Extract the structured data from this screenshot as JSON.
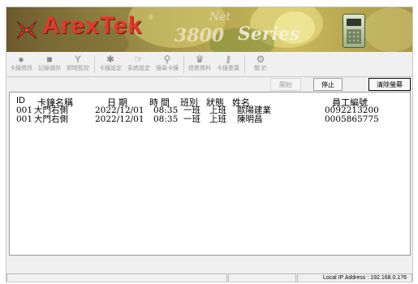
{
  "banner": {
    "brand": "ArexTek",
    "registered": "®",
    "model": "3800",
    "model_suffix": "Net",
    "series": "Series"
  },
  "toolbar": {
    "items": [
      {
        "icon": "●",
        "label": "卡鐘資訊"
      },
      {
        "icon": "■",
        "label": "記錄儲存"
      },
      {
        "icon": "Y",
        "label": "即時監控"
      },
      {
        "icon": "✱",
        "label": "卡鐘設定"
      },
      {
        "icon": "☞",
        "label": "系統設定"
      },
      {
        "icon": "⚲",
        "label": "搜尋卡鐘"
      },
      {
        "icon": "♛",
        "label": "授救資料"
      },
      {
        "icon": "⚷",
        "label": "卡鐘重置"
      },
      {
        "icon": "⚙",
        "label": "關 於"
      }
    ]
  },
  "controls": {
    "open": "開始",
    "stop": "停止",
    "clear": "清除螢幕"
  },
  "table": {
    "columns": {
      "id": "ID",
      "name": "卡鐘名稱",
      "date": "日 期",
      "time": "時 間",
      "shift": "班別",
      "status": "狀態",
      "person": "姓名",
      "employee": "員工編號"
    },
    "rows": [
      {
        "id": "001",
        "name": "大門右側",
        "date": "2022/12/01",
        "time": "08:35",
        "shift": "一班",
        "status": "上班",
        "person": "歐陽建業",
        "employee": "0092213200"
      },
      {
        "id": "001",
        "name": "大門右側",
        "date": "2022/12/01",
        "time": "08:35",
        "shift": "一班",
        "status": "上班",
        "person": "陳明昌",
        "employee": "0005865775"
      }
    ]
  },
  "statusbar": {
    "ip": "Local IP Address : 192.168.0.176"
  }
}
